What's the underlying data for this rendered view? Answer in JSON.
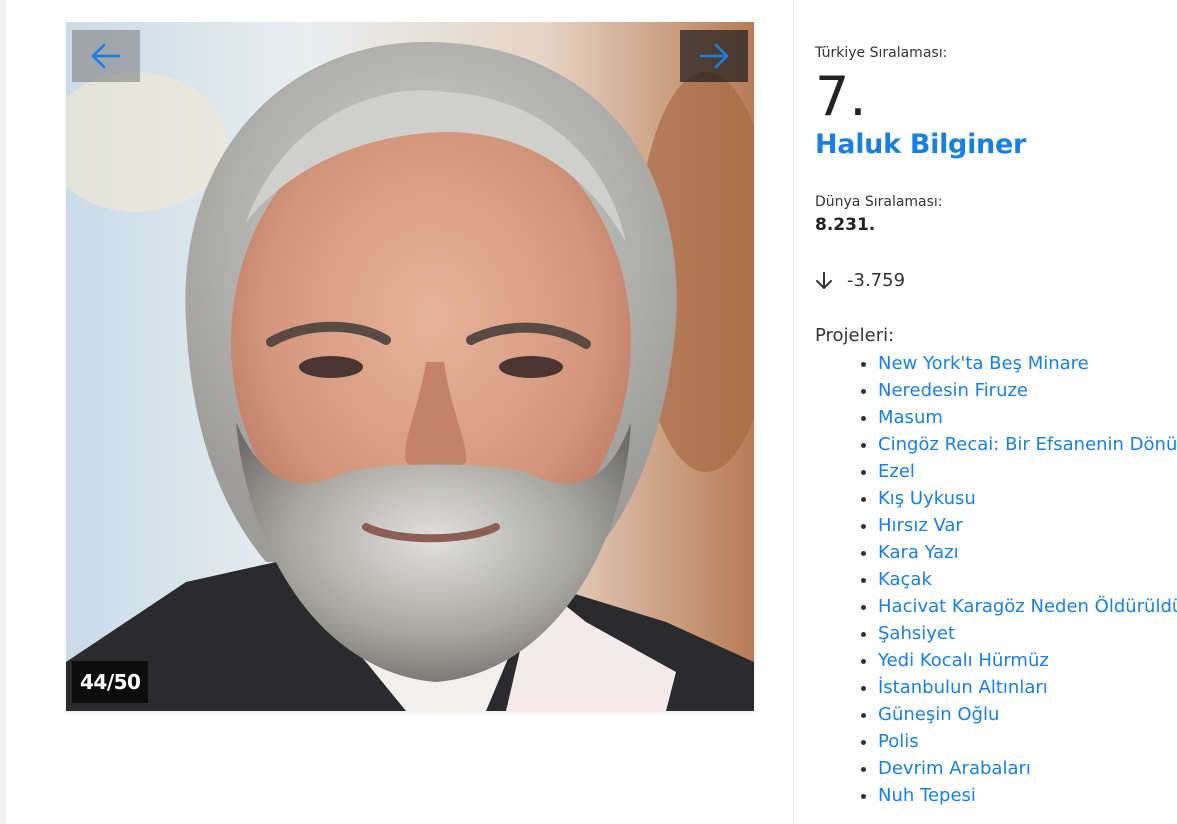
{
  "gallery": {
    "counter": "44/50",
    "prev_icon": "arrow-left-icon",
    "next_icon": "arrow-right-icon",
    "accent_color": "#1a7fe0"
  },
  "ranking": {
    "turkey_label": "Türkiye Sıralaması:",
    "turkey_rank": "7.",
    "name": "Haluk Bilginer",
    "world_label": "Dünya Sıralaması:",
    "world_rank": "8.231.",
    "change_icon": "arrow-down-icon",
    "change_value": "-3.759"
  },
  "projects": {
    "label": "Projeleri:",
    "items": [
      "New York'ta Beş Minare",
      "Neredesin Firuze",
      "Masum",
      "Cingöz Recai: Bir Efsanenin Dönüş",
      "Ezel",
      "Kış Uykusu",
      "Hırsız Var",
      "Kara Yazı",
      "Kaçak",
      "Hacivat Karagöz Neden Öldürüldü",
      "Şahsiyet",
      "Yedi Kocalı Hürmüz",
      "İstanbulun Altınları",
      "Güneşin Oğlu",
      "Polis",
      "Devrim Arabaları",
      "Nuh Tepesi"
    ]
  }
}
